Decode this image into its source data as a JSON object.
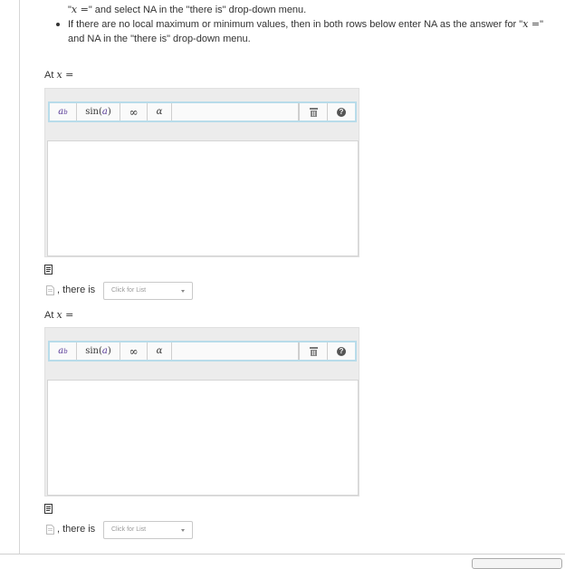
{
  "instructions": {
    "line1_open": "\"",
    "line1_math": "x =",
    "line1_rest": "\"  and select NA in the \"there is\" drop-down menu.",
    "line2": "If there are no local maximum or minimum values, then in both rows below enter NA as the answer for \"",
    "line2_math": "x =",
    "line2_close": "\"",
    "line3": "and NA in the \"there is\" drop-down menu."
  },
  "rows": [
    {
      "at_label": "At",
      "at_math": "x =",
      "toolbar": {
        "superscript_base": "a",
        "superscript_exp": "b",
        "sin": "sin",
        "sin_arg": "a",
        "infinity": "∞",
        "alpha": "α",
        "trash_icon": "trash-icon",
        "help": "?"
      },
      "there_is_label": ", there is",
      "dropdown_placeholder": "Click for List"
    },
    {
      "at_label": "At",
      "at_math": "x =",
      "toolbar": {
        "superscript_base": "a",
        "superscript_exp": "b",
        "sin": "sin",
        "sin_arg": "a",
        "infinity": "∞",
        "alpha": "α",
        "trash_icon": "trash-icon",
        "help": "?"
      },
      "there_is_label": ", there is",
      "dropdown_placeholder": "Click for List"
    }
  ],
  "colors": {
    "toolbar_border": "#b8dcea",
    "superscript": "#5a3d99",
    "editor_bg": "#ececec"
  }
}
